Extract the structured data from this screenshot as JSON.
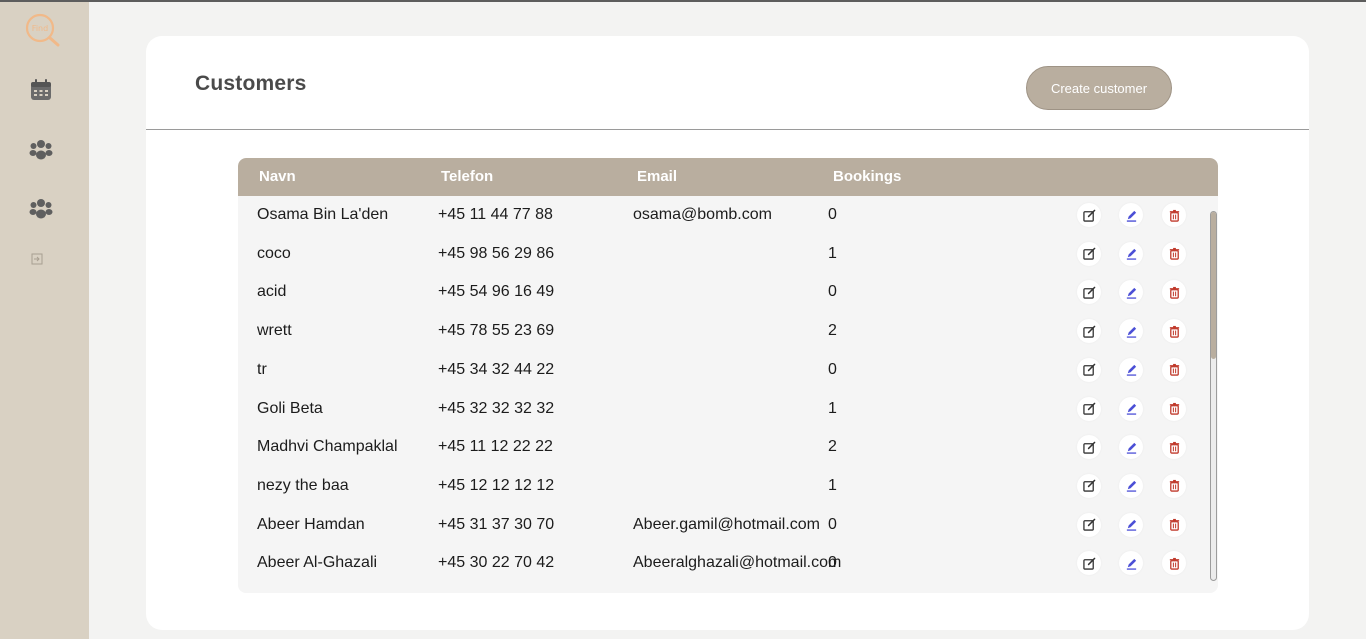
{
  "sidebar": {
    "logo_text": "Find",
    "items": [
      {
        "icon": "calendar-icon"
      },
      {
        "icon": "group-icon"
      },
      {
        "icon": "group-icon"
      },
      {
        "icon": "logout-icon"
      }
    ]
  },
  "header": {
    "title": "Customers",
    "create_button_label": "Create customer"
  },
  "table": {
    "columns": [
      "Navn",
      "Telefon",
      "Email",
      "Bookings"
    ],
    "rows": [
      {
        "name": "Osama Bin La'den",
        "phone": "+45 11 44 77 88",
        "email": "osama@bomb.com",
        "bookings": "0"
      },
      {
        "name": "coco",
        "phone": "+45 98 56 29 86",
        "email": "",
        "bookings": "1"
      },
      {
        "name": "acid",
        "phone": "+45 54 96 16 49",
        "email": "",
        "bookings": "0"
      },
      {
        "name": "wrett",
        "phone": "+45 78 55 23 69",
        "email": "",
        "bookings": "2"
      },
      {
        "name": "tr",
        "phone": "+45 34 32 44 22",
        "email": "",
        "bookings": "0"
      },
      {
        "name": "Goli Beta",
        "phone": "+45 32 32 32 32",
        "email": "",
        "bookings": "1"
      },
      {
        "name": "Madhvi Champaklal",
        "phone": "+45 11 12 22 22",
        "email": "",
        "bookings": "2"
      },
      {
        "name": "nezy the baa",
        "phone": "+45 12 12 12 12",
        "email": "",
        "bookings": "1"
      },
      {
        "name": "Abeer Hamdan",
        "phone": "+45 31 37 30 70",
        "email": "Abeer.gamil@hotmail.com",
        "bookings": "0"
      },
      {
        "name": "Abeer Al-Ghazali",
        "phone": "+45 30 22 70 42",
        "email": "Abeeralghazali@hotmail.com",
        "bookings": "0"
      }
    ],
    "scroll_fraction": 0.4
  },
  "colors": {
    "accent": "#b9ae9f",
    "sidebar": "#d9d1c3",
    "edit_icon": "#333333",
    "pen_icon": "#4b4fd6",
    "delete_icon": "#c0392b"
  }
}
